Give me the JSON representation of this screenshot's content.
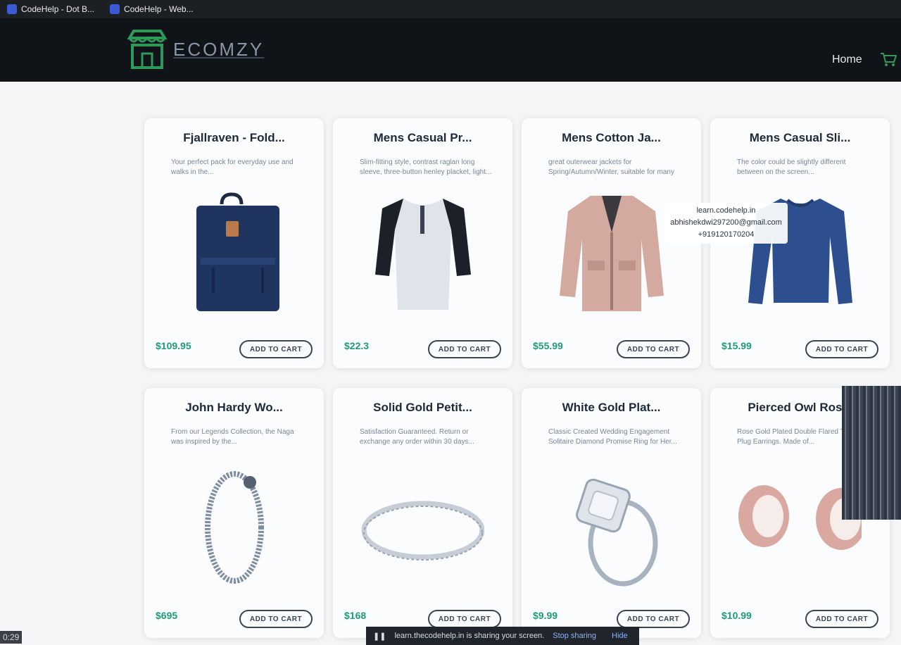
{
  "browser": {
    "tabs": [
      {
        "title": "CodeHelp - Dot B..."
      },
      {
        "title": "CodeHelp - Web..."
      }
    ]
  },
  "navbar": {
    "logo_text": "ECOMZY",
    "home_label": "Home",
    "brand_color": "#2e9a5a"
  },
  "products": [
    {
      "title": "Fjallraven - Fold...",
      "description": "Your perfect pack for everyday use and walks in the...",
      "price": "$109.95",
      "button": "ADD TO CART",
      "image": "backpack-icon"
    },
    {
      "title": "Mens Casual Pr...",
      "description": "Slim-fitting style, contrast raglan long sleeve, three-button henley placket, light...",
      "price": "$22.3",
      "button": "ADD TO CART",
      "image": "raglan-shirt-icon"
    },
    {
      "title": "Mens Cotton Ja...",
      "description": "great outerwear jackets for Spring/Autumn/Winter, suitable for many occasions, such...",
      "price": "$55.99",
      "button": "ADD TO CART",
      "image": "jacket-icon"
    },
    {
      "title": "Mens Casual Sli...",
      "description": "The color could be slightly different between on the screen...",
      "price": "$15.99",
      "button": "ADD TO CART",
      "image": "long-sleeve-shirt-icon"
    },
    {
      "title": "John Hardy Wo...",
      "description": "From our Legends Collection, the Naga was inspired by the...",
      "price": "$695",
      "button": "ADD TO CART",
      "image": "bracelet-icon"
    },
    {
      "title": "Solid Gold Petit...",
      "description": "Satisfaction Guaranteed. Return or exchange any order within 30 days...",
      "price": "$168",
      "button": "ADD TO CART",
      "image": "gold-bangle-icon"
    },
    {
      "title": "White Gold Plat...",
      "description": "Classic Created Wedding Engagement Solitaire Diamond Promise Ring for Her...",
      "price": "$9.99",
      "button": "ADD TO CART",
      "image": "ring-icon"
    },
    {
      "title": "Pierced Owl Ros...",
      "description": "Rose Gold Plated Double Flared Tunnel Plug Earrings. Made of...",
      "price": "$10.99",
      "button": "ADD TO CART",
      "image": "rose-gold-plugs-icon"
    }
  ],
  "watermark": {
    "line1": "learn.codehelp.in",
    "line2": "abhishekdwi297200@gmail.com",
    "line3": "+919120170204"
  },
  "share_bar": {
    "message": "learn.thecodehelp.in is sharing your screen.",
    "stop_label": "Stop sharing",
    "hide_label": "Hide"
  },
  "taskbar": {
    "time": "0:29"
  },
  "colors": {
    "price": "#1f9a7a",
    "navbar": "#101418",
    "page": "#f3f5f7"
  }
}
